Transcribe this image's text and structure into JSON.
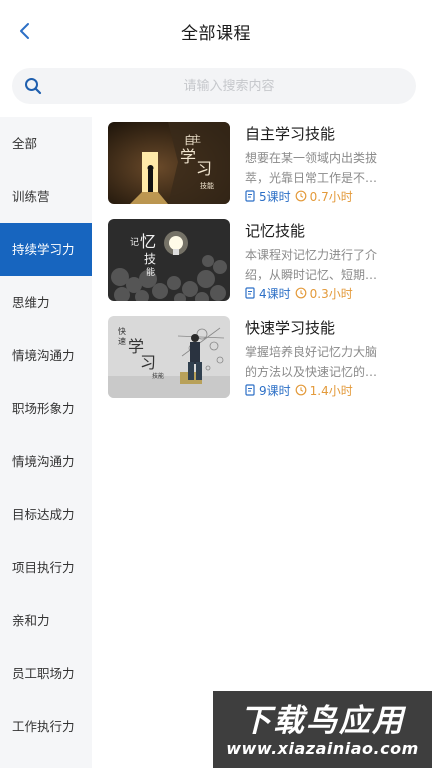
{
  "header": {
    "title": "全部课程",
    "back_icon": "chevron-left-icon"
  },
  "search": {
    "placeholder": "请输入搜索内容",
    "value": "",
    "icon": "search-icon"
  },
  "sidebar": {
    "items": [
      {
        "label": "全部",
        "active": false
      },
      {
        "label": "训练营",
        "active": false
      },
      {
        "label": "持续学习力",
        "active": true
      },
      {
        "label": "思维力",
        "active": false
      },
      {
        "label": "情境沟通力",
        "active": false
      },
      {
        "label": "职场形象力",
        "active": false
      },
      {
        "label": "情境沟通力",
        "active": false
      },
      {
        "label": "目标达成力",
        "active": false
      },
      {
        "label": "项目执行力",
        "active": false
      },
      {
        "label": "亲和力",
        "active": false
      },
      {
        "label": "员工职场力",
        "active": false
      },
      {
        "label": "工作执行力",
        "active": false
      }
    ]
  },
  "courses": [
    {
      "title": "自主学习技能",
      "description": "想要在某一领域内出类拔萃，光靠日常工作是不…",
      "lessons": "5课时",
      "hours": "0.7小时",
      "thumb_text": "自主学习技能"
    },
    {
      "title": "记忆技能",
      "description": "本课程对记忆力进行了介绍，从瞬时记忆、短期…",
      "lessons": "4课时",
      "hours": "0.3小时",
      "thumb_text": "记忆技能"
    },
    {
      "title": "快速学习技能",
      "description": "掌握培养良好记忆力大脑的方法以及快速记忆的…",
      "lessons": "9课时",
      "hours": "1.4小时",
      "thumb_text": "快速学习技能"
    }
  ],
  "watermark": {
    "text": "下载鸟应用",
    "url": "www.xiazainiao.com"
  },
  "colors": {
    "accent": "#1765bf",
    "lessons": "#2c6fc6",
    "hours": "#e39a3b",
    "sidebar_bg": "#f5f6f8"
  }
}
